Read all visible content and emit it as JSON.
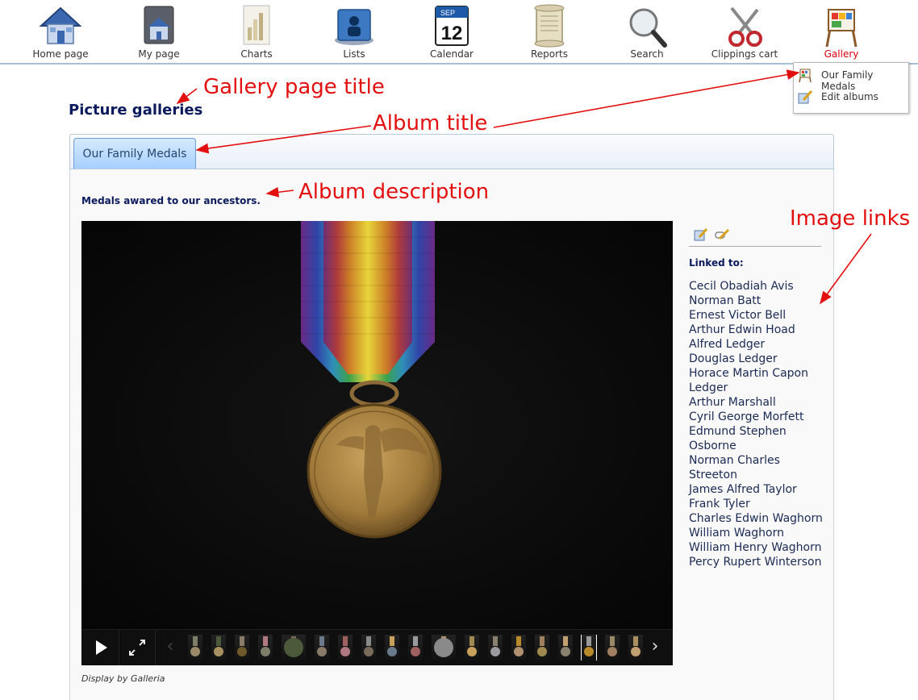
{
  "menu": {
    "items": [
      {
        "label": "Home page",
        "icon": "home-icon"
      },
      {
        "label": "My page",
        "icon": "my-page-icon"
      },
      {
        "label": "Charts",
        "icon": "charts-icon"
      },
      {
        "label": "Lists",
        "icon": "lists-icon"
      },
      {
        "label": "Calendar",
        "icon": "calendar-icon",
        "day": "12",
        "month": "SEP"
      },
      {
        "label": "Reports",
        "icon": "reports-scroll-icon"
      },
      {
        "label": "Search",
        "icon": "magnifier-icon"
      },
      {
        "label": "Clippings cart",
        "icon": "scissors-icon"
      },
      {
        "label": "Gallery",
        "icon": "easel-icon",
        "active": true
      }
    ],
    "gallery_dropdown": [
      {
        "label": "Our Family Medals",
        "icon": "easel-icon"
      },
      {
        "label": "Edit albums",
        "icon": "edit-icon"
      }
    ]
  },
  "annotations": {
    "gallery_page_title": "Gallery page title",
    "album_title": "Album title",
    "album_description": "Album description",
    "image_links": "Image links"
  },
  "page": {
    "title": "Picture galleries"
  },
  "album": {
    "tab_label": "Our Family Medals",
    "description": "Medals awared to our ancestors."
  },
  "viewer": {
    "credit": "Display by Galleria",
    "active_thumb_index": 16,
    "thumb_count": 20
  },
  "image_links": {
    "label": "Linked to:",
    "names": [
      "Cecil Obadiah Avis",
      "Norman Batt",
      "Ernest Victor Bell",
      "Arthur Edwin Hoad",
      "Alfred Ledger",
      "Douglas Ledger",
      "Horace Martin Capon",
      "Ledger",
      "Arthur Marshall",
      "Cyril George Morfett",
      "Edmund Stephen",
      "Osborne",
      "Norman Charles Streeton",
      "James Alfred Taylor",
      "Frank Tyler",
      "Charles Edwin Waghorn",
      "William Waghorn",
      "William Henry Waghorn",
      "Percy Rupert Winterson"
    ]
  },
  "colors": {
    "accent_red": "#e31010",
    "title_navy": "#0b1a5c",
    "tab_blue": "#a7cfff"
  }
}
